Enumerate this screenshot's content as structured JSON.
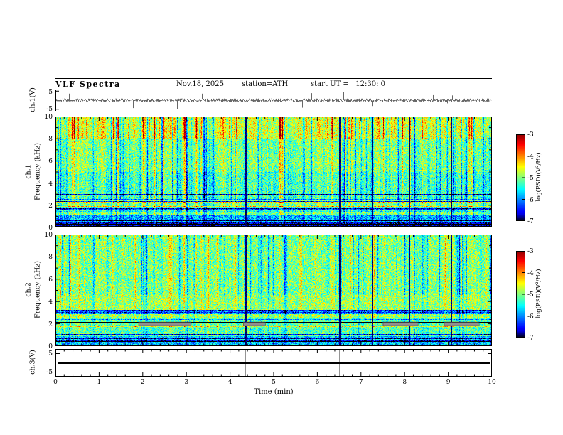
{
  "header": {
    "title": "VLF Spectra",
    "date": "Nov.18, 2025",
    "station": "station=ATH",
    "start_ut": "start UT =   12:30: 0"
  },
  "axes": {
    "time_label": "Time (min)",
    "time_ticks": [
      "0",
      "1",
      "2",
      "3",
      "4",
      "5",
      "6",
      "7",
      "8",
      "9",
      "10"
    ],
    "freq_label": "Frequency (kHz)",
    "freq_ticks": [
      "10",
      "8",
      "6",
      "4",
      "2",
      "0"
    ],
    "volt_ticks": [
      "5",
      "-5"
    ]
  },
  "panels": {
    "ch1_wave_label": "ch.1(V)",
    "ch1_spec_label": "ch.1",
    "ch2_spec_label": "ch.2",
    "ch3_wave_label": "ch.3(V)"
  },
  "colorbar": {
    "label": "log(PSD)(V²/Hz)",
    "ticks": [
      "-3",
      "-4",
      "-5",
      "-6",
      "-7"
    ]
  },
  "chart_data": [
    {
      "type": "line",
      "panel": "ch.1(V) waveform",
      "xlim": [
        0,
        10
      ],
      "ylim": [
        -5,
        5
      ],
      "yticks": [
        5,
        -5
      ],
      "description": "Dense broadband noise voltage trace centred on 0 V with frequent impulsive sferic spikes reaching roughly ±4 V throughout the 10-minute record"
    },
    {
      "type": "heatmap",
      "panel": "ch.1 spectrogram",
      "xlabel": "Time (min)",
      "ylabel": "Frequency (kHz)",
      "xlim": [
        0,
        10
      ],
      "ylim": [
        0,
        10
      ],
      "yticks": [
        0,
        2,
        4,
        6,
        8,
        10
      ],
      "z_label": "log(PSD)(V²/Hz)",
      "zlim": [
        -7,
        -3
      ],
      "colormap": "jet",
      "dark_column_lines_min": [
        4.35,
        6.5,
        7.25,
        8.1,
        9.05
      ],
      "description": "Green/yellow broadband hiss with red-orange impulsive bursts strongest above 8 kHz, dense dark-blue vertical striations between 2 and 8 kHz, a bright yellow horizontal line near 1.9 kHz, and dark banded structure with near-black rows below about 1 kHz"
    },
    {
      "type": "heatmap",
      "panel": "ch.2 spectrogram",
      "xlabel": "Time (min)",
      "ylabel": "Frequency (kHz)",
      "xlim": [
        0,
        10
      ],
      "ylim": [
        0,
        10
      ],
      "yticks": [
        0,
        2,
        4,
        6,
        8,
        10
      ],
      "z_label": "log(PSD)(V²/Hz)",
      "zlim": [
        -7,
        -3
      ],
      "colormap": "jet",
      "dark_column_lines_min": [
        4.35,
        6.5,
        7.25,
        8.1,
        9.05
      ],
      "gray_segments_min": [
        [
          1.9,
          3.1
        ],
        [
          4.3,
          4.8
        ],
        [
          7.5,
          8.3
        ],
        [
          8.9,
          9.7
        ]
      ],
      "gray_segment_freq_khz": 2,
      "description": "Mostly uniform green-yellow hiss; blue vertical striations above ~5 kHz, brighter yellow-green band 2.6-4.6 kHz, many thin dark horizontal lines below 2.5 kHz, and gray instrument-dropout bars near 2 kHz at about 1.9-3.1, 4.3-4.8, 7.5-8.3 and 8.9-9.7 min"
    },
    {
      "type": "line",
      "panel": "ch.3(V) waveform",
      "xlim": [
        0,
        10
      ],
      "ylim": [
        -5,
        5
      ],
      "yticks": [
        5,
        -5
      ],
      "vertical_grid_lines_min": [
        4.35,
        6.5,
        7.25,
        8.1,
        9.05
      ],
      "description": "Flat thick black line at 0 V - channel recording no signal"
    }
  ]
}
